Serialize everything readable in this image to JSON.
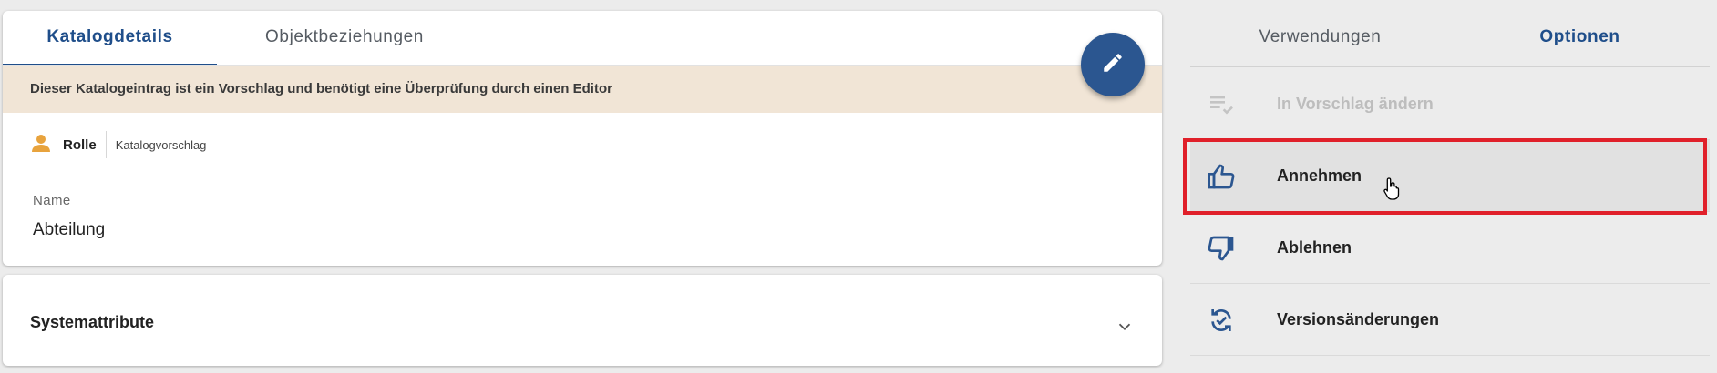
{
  "left_tabs": [
    {
      "label": "Katalogdetails",
      "active": true
    },
    {
      "label": "Objektbeziehungen",
      "active": false
    }
  ],
  "banner_text": "Dieser Katalogeintrag ist ein Vorschlag und benötigt eine Überprüfung durch einen Editor",
  "edit_button_icon": "pencil-icon",
  "entry": {
    "type_icon": "person-icon",
    "type_label": "Rolle",
    "status": "Katalogvorschlag",
    "field_label": "Name",
    "field_value": "Abteilung"
  },
  "system_attributes": {
    "title": "Systemattribute",
    "icon": "chevron-down-icon"
  },
  "right_tabs": [
    {
      "label": "Verwendungen",
      "active": false
    },
    {
      "label": "Optionen",
      "active": true
    }
  ],
  "options": [
    {
      "label": "In Vorschlag ändern",
      "icon": "playlist-check-icon",
      "disabled": true
    },
    {
      "label": "Annehmen",
      "icon": "thumb-up-icon",
      "disabled": false,
      "highlighted": true
    },
    {
      "label": "Ablehnen",
      "icon": "thumb-down-icon",
      "disabled": false
    },
    {
      "label": "Versionsänderungen",
      "icon": "sync-check-icon",
      "disabled": false
    }
  ],
  "colors": {
    "accent": "#1f4e8a",
    "fab": "#2b5690",
    "banner_bg": "#f1e5d6",
    "person_icon": "#e8a33d",
    "highlight": "#e0202a",
    "disabled_text": "#bdbdbd"
  }
}
